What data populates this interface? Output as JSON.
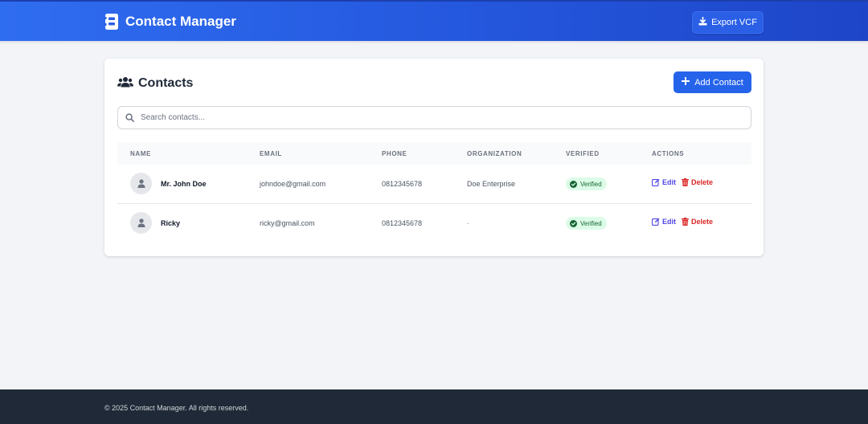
{
  "header": {
    "title": "Contact Manager",
    "brand_icon": "address-book-icon",
    "export_label": "Export VCF",
    "export_icon": "download-icon"
  },
  "contacts_card": {
    "title": "Contacts",
    "title_icon": "users-icon",
    "add_label": "Add Contact",
    "add_icon": "plus-icon",
    "search_placeholder": "Search contacts...",
    "columns": [
      "Name",
      "Email",
      "Phone",
      "Organization",
      "Verified",
      "Actions"
    ],
    "rows": [
      {
        "name": "Mr. John Doe",
        "email": "johndoe@gmail.com",
        "phone": "0812345678",
        "organization": "Doe Enterprise",
        "verified": "Verified",
        "edit_label": "Edit",
        "delete_label": "Delete"
      },
      {
        "name": "Ricky",
        "email": "ricky@gmail.com",
        "phone": "0812345678",
        "organization": "-",
        "verified": "Verified",
        "edit_label": "Edit",
        "delete_label": "Delete"
      }
    ]
  },
  "footer": {
    "text": "© 2025 Contact Manager. All rights reserved."
  },
  "colors": {
    "primary": "#2563eb",
    "header_start": "#2f6df0",
    "header_end": "#1e45c7",
    "verified_bg": "#dcfce7",
    "verified_text": "#166534",
    "edit": "#4f46e5",
    "delete": "#dc2626",
    "footer_bg": "#1f2937"
  }
}
